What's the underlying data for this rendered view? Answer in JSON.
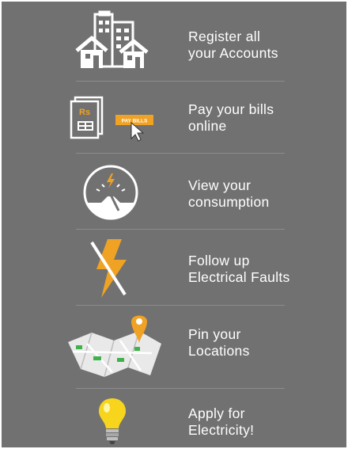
{
  "colors": {
    "panel_bg": "#717171",
    "accent_orange": "#f0a224",
    "icon_white": "#ffffff",
    "bulb_yellow": "#f7d51d",
    "map_green": "#3fb24a"
  },
  "features": [
    {
      "icon": "buildings-icon",
      "line1": "Register all",
      "line2": "your Accounts"
    },
    {
      "icon": "bills-icon",
      "line1": "Pay your bills",
      "line2": "online",
      "badge": "PAY BILLS",
      "receipt_mark": "Rs"
    },
    {
      "icon": "meter-icon",
      "line1": "View your",
      "line2": "consumption"
    },
    {
      "icon": "fault-bolt-icon",
      "line1": "Follow up",
      "line2": "Electrical Faults"
    },
    {
      "icon": "map-pin-icon",
      "line1": "Pin your",
      "line2": "Locations"
    },
    {
      "icon": "lightbulb-icon",
      "line1": "Apply for",
      "line2": "Electricity!"
    }
  ]
}
